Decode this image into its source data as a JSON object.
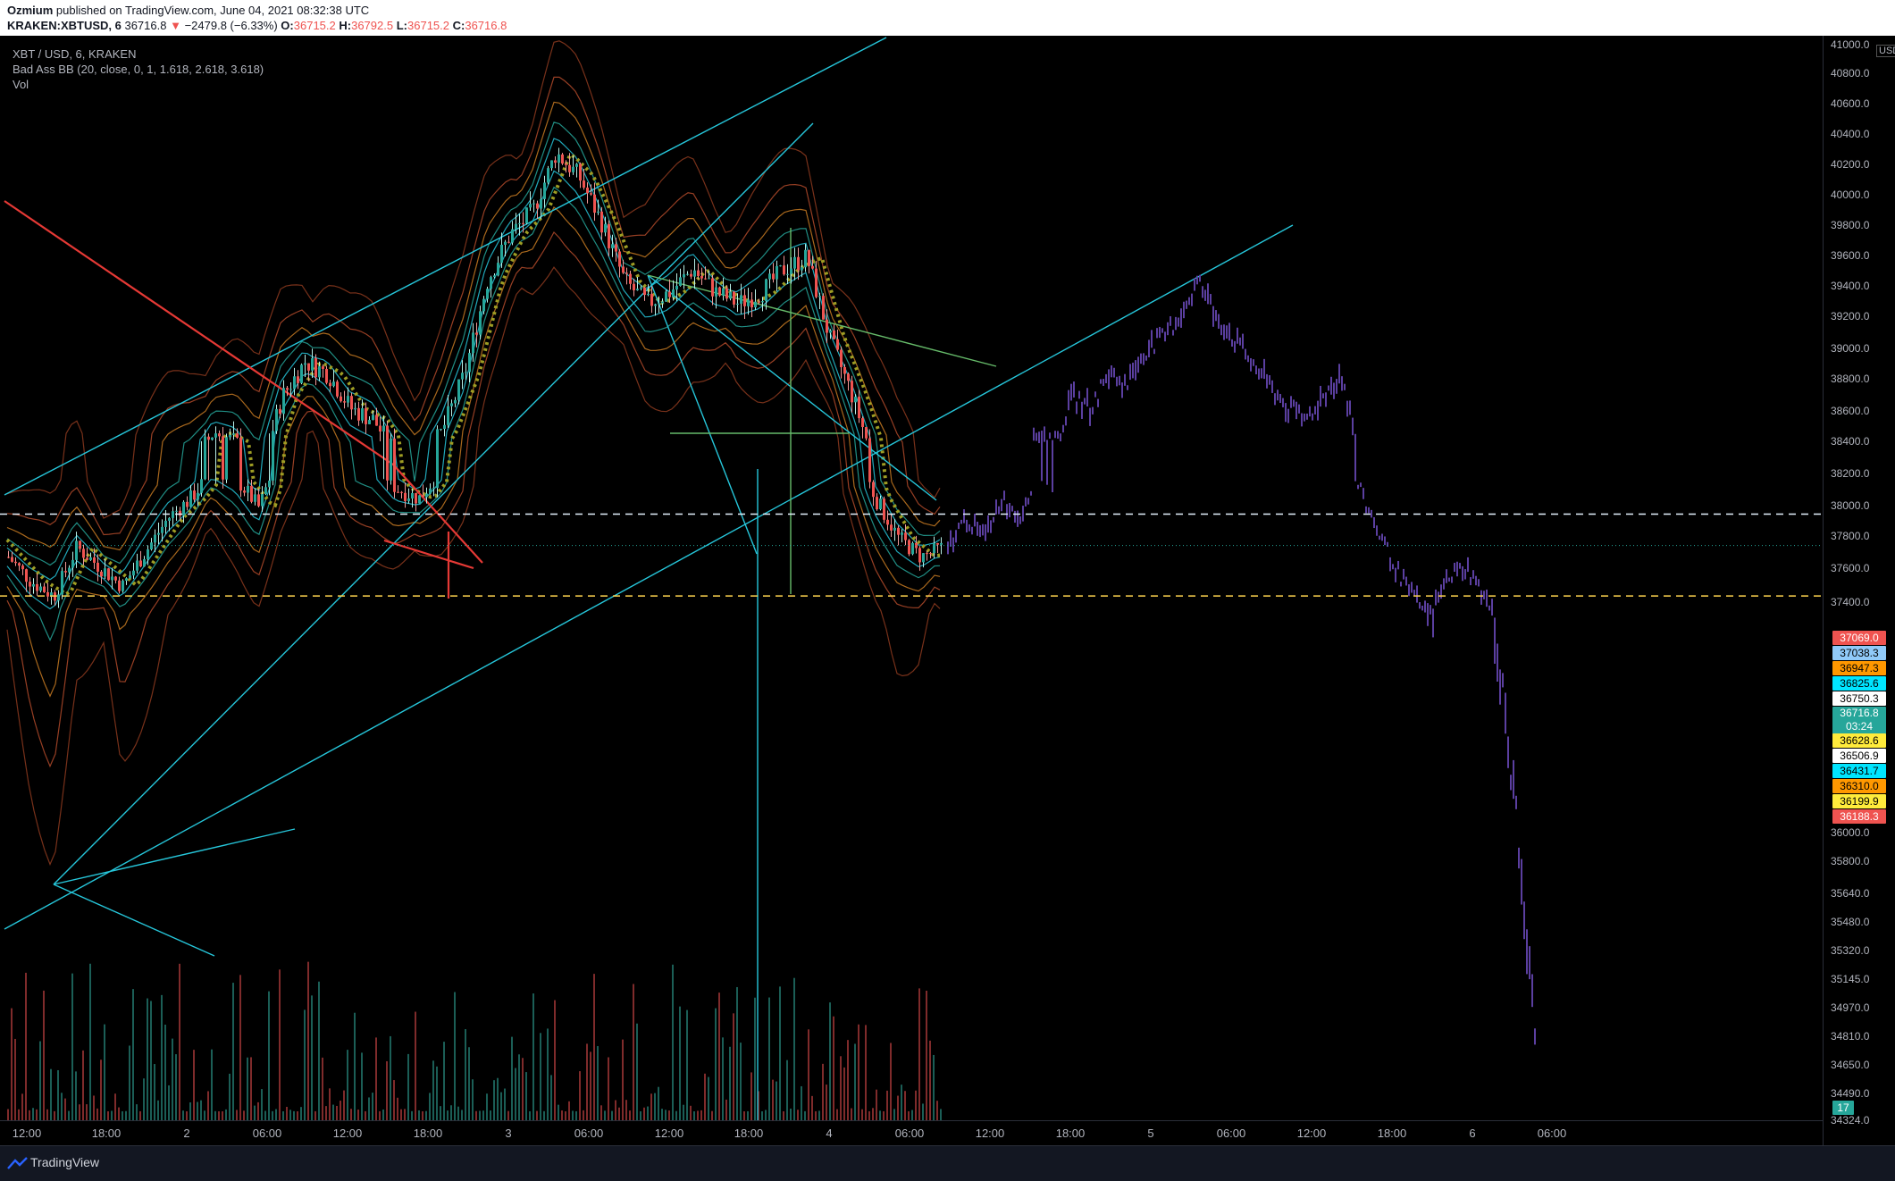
{
  "header": {
    "author": "Ozmium",
    "published": "published on TradingView.com, June 04, 2021 08:32:38 UTC",
    "symbol": "KRAKEN:XBTUSD, 6",
    "last": "36716.8",
    "change": "−2479.8 (−6.33%)",
    "o_label": "O:",
    "o": "36715.2",
    "h_label": "H:",
    "h": "36792.5",
    "l_label": "L:",
    "l": "36715.2",
    "c_label": "C:",
    "c": "36716.8"
  },
  "legend": {
    "pair": "XBT / USD, 6, KRAKEN",
    "indicator": "Bad Ass BB (20, close, 0, 1, 1.618, 2.618, 3.618)",
    "volume": "Vol"
  },
  "price_axis": {
    "currency": "USD",
    "ticks": [
      "41000.0",
      "40800.0",
      "40600.0",
      "40400.0",
      "40200.0",
      "40000.0",
      "39800.0",
      "39600.0",
      "39400.0",
      "39200.0",
      "39000.0",
      "38800.0",
      "38600.0",
      "38400.0",
      "38200.0",
      "38000.0",
      "37800.0",
      "37600.0",
      "37400.0",
      "36000.0",
      "35800.0",
      "35640.0",
      "35480.0",
      "35320.0",
      "35145.0",
      "34970.0",
      "34810.0",
      "34650.0",
      "34490.0",
      "34324.0"
    ],
    "labels": [
      {
        "text": "37069.0",
        "color": "#ef5350"
      },
      {
        "text": "37038.3",
        "color": "#90caf9"
      },
      {
        "text": "36947.3",
        "color": "#ff9800"
      },
      {
        "text": "36825.6",
        "color": "#00e5ff"
      },
      {
        "text": "36750.3",
        "color": "#ffffff"
      },
      {
        "text": "36716.8",
        "color": "#26a69a",
        "sub": "03:24"
      },
      {
        "text": "36628.6",
        "color": "#ffeb3b"
      },
      {
        "text": "36506.9",
        "color": "#ffffff"
      },
      {
        "text": "36431.7",
        "color": "#00e5ff"
      },
      {
        "text": "36310.0",
        "color": "#ff9800"
      },
      {
        "text": "36199.9",
        "color": "#ffeb3b"
      },
      {
        "text": "36188.3",
        "color": "#ef5350"
      }
    ],
    "volume_label": "17"
  },
  "time_axis": {
    "ticks": [
      "12:00",
      "18:00",
      "2",
      "06:00",
      "12:00",
      "18:00",
      "3",
      "06:00",
      "12:00",
      "18:00",
      "4",
      "06:00",
      "12:00",
      "18:00",
      "5",
      "06:00",
      "12:00",
      "18:00",
      "6",
      "06:00"
    ]
  },
  "footer": {
    "brand": "TradingView"
  },
  "chart_data": {
    "type": "candlestick",
    "instrument": "KRAKEN:XBTUSD",
    "timeframe": "6",
    "x_ticks": [
      "12:00",
      "18:00",
      "2",
      "06:00",
      "12:00",
      "18:00",
      "3",
      "06:00",
      "12:00",
      "18:00",
      "4",
      "06:00",
      "12:00",
      "18:00",
      "5",
      "06:00",
      "12:00",
      "18:00",
      "6",
      "06:00"
    ],
    "y_range": [
      34324,
      41000
    ],
    "last_price": 36716.8,
    "horizontal_levels": [
      37038.3,
      36199.9
    ],
    "colors": {
      "up": "#26a69a",
      "down": "#ef5350",
      "projection": "#5b3fa0",
      "channel": "#26c6da",
      "trend": "#e53935",
      "triangle": "#66bb6a",
      "bb_mid": "#9e9d24"
    },
    "price_path": [
      36600,
      36350,
      36200,
      36700,
      36500,
      36300,
      36650,
      37000,
      37200,
      37500,
      37400,
      37100,
      37800,
      38100,
      38000,
      37700,
      37600,
      37300,
      37200,
      37500,
      38000,
      38800,
      39200,
      39400,
      39900,
      39700,
      39300,
      38800,
      38600,
      38700,
      38900,
      38700,
      38600,
      38700,
      38900,
      39000,
      38300,
      37800,
      37200,
      36800,
      36600,
      36700
    ],
    "projection_path": [
      36700,
      37000,
      36800,
      37200,
      37000,
      37500,
      37400,
      37800,
      37700,
      38000,
      37900,
      38200,
      38300,
      38500,
      38800,
      38500,
      38300,
      38100,
      37900,
      37700,
      37600,
      37800,
      38000,
      37300,
      36900,
      36500,
      36200,
      36000,
      36400,
      36500,
      36200,
      35800,
      35200,
      34500
    ]
  }
}
